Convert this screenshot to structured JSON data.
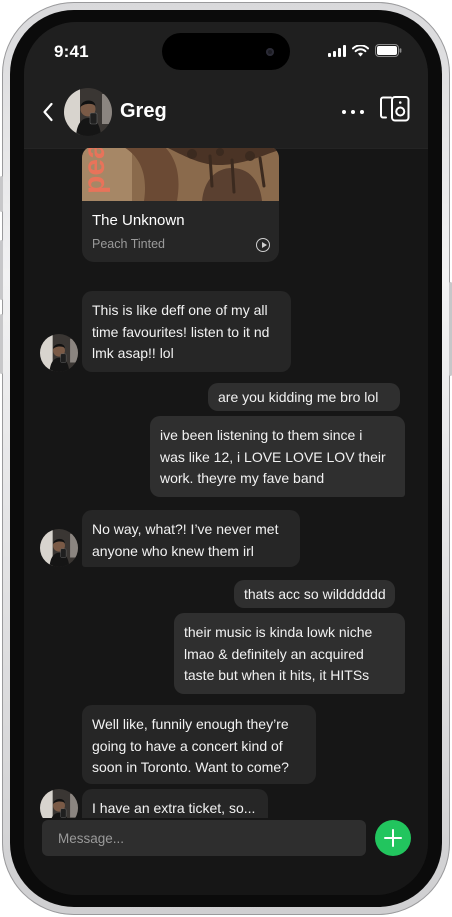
{
  "status_bar": {
    "time": "9:41"
  },
  "header": {
    "contact_name": "Greg"
  },
  "shared_track": {
    "cover_text": "pea",
    "title": "The Unknown",
    "artist": "Peach Tinted"
  },
  "messages": [
    {
      "from": "them",
      "lines": [
        "This is like deff one of my all",
        "time favourites! listen to it nd",
        "lmk asap!! lol"
      ]
    },
    {
      "from": "me",
      "lines": [
        "are you kidding me bro lol"
      ]
    },
    {
      "from": "me",
      "lines": [
        "ive been listening to them since i",
        "was like 12, i LOVE LOVE LOV their",
        "work. theyre my fave band"
      ]
    },
    {
      "from": "them",
      "lines": [
        "No way, what?! I’ve never met",
        "anyone who knew them irl"
      ]
    },
    {
      "from": "me",
      "lines": [
        "thats acc so wildddddd"
      ]
    },
    {
      "from": "me",
      "lines": [
        "their music is kinda lowk niche",
        "lmao & definitely an acquired",
        "taste but when it hits, it HITSs"
      ]
    },
    {
      "from": "them",
      "lines": [
        "Well like, funnily enough they’re",
        "going to have a concert kind of",
        "soon in Toronto. Want to come?"
      ]
    },
    {
      "from": "them",
      "lines": [
        "I have an extra ticket, so..."
      ]
    }
  ],
  "composer": {
    "placeholder": "Message..."
  },
  "colors": {
    "accent": "#22c55e",
    "screen_bg": "#161616",
    "bubble_in": "#262626",
    "bubble_out": "#2f2f2f"
  }
}
